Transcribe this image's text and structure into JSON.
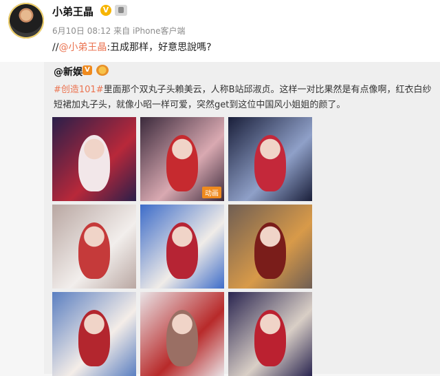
{
  "post": {
    "author": "小弟王晶",
    "verified_badge": "V",
    "time": "6月10日 08:12",
    "source": "来自 iPhone客户端",
    "comment_prefix": "//",
    "comment_mention": "@小弟王晶",
    "comment_text": ":丑成那样，好意思說嗎?"
  },
  "reposted": {
    "author": "@新娱",
    "verified_badge": "V",
    "hashtag": "#创造101#",
    "text": "里面那个双丸子头賴美云，人称B站邱淑贞。这样一对比果然是有点像啊，红衣白纱短裙加丸子头，就像小昭一样可爱，突然get到这位中国风小姐姐的颜了。",
    "images": [
      {
        "gif_label": "",
        "caption": "",
        "colors": [
          "#2a1f4a",
          "#b8283a",
          "#f2e7e9"
        ]
      },
      {
        "gif_label": "动画",
        "caption": "",
        "colors": [
          "#3b2a3c",
          "#d9a9b1",
          "#c62a2f"
        ]
      },
      {
        "gif_label": "",
        "caption": "",
        "colors": [
          "#1a1f3a",
          "#8fa0c8",
          "#c4283a"
        ]
      },
      {
        "gif_label": "",
        "caption": "",
        "colors": [
          "#b9a7a2",
          "#f2eeec",
          "#c53a3a"
        ]
      },
      {
        "gif_label": "",
        "caption": "",
        "colors": [
          "#3d6cc9",
          "#f0ece8",
          "#b62434"
        ]
      },
      {
        "gif_label": "",
        "caption": "",
        "colors": [
          "#6f5e53",
          "#d89a49",
          "#7a1d1a"
        ]
      },
      {
        "gif_label": "",
        "caption": "",
        "colors": [
          "#5b7fc1",
          "#f4ede8",
          "#b3262e"
        ]
      },
      {
        "gif_label": "",
        "caption": "",
        "colors": [
          "#e9e3e6",
          "#b82a2a",
          "#9a6f64"
        ]
      },
      {
        "gif_label": "",
        "caption": "",
        "colors": [
          "#2a2550",
          "#d9cfc6",
          "#bb2130"
        ]
      }
    ]
  },
  "colors": {
    "link": "#eb7350",
    "badge_gold": "#f7b500",
    "badge_orange": "#ef8a1e"
  }
}
